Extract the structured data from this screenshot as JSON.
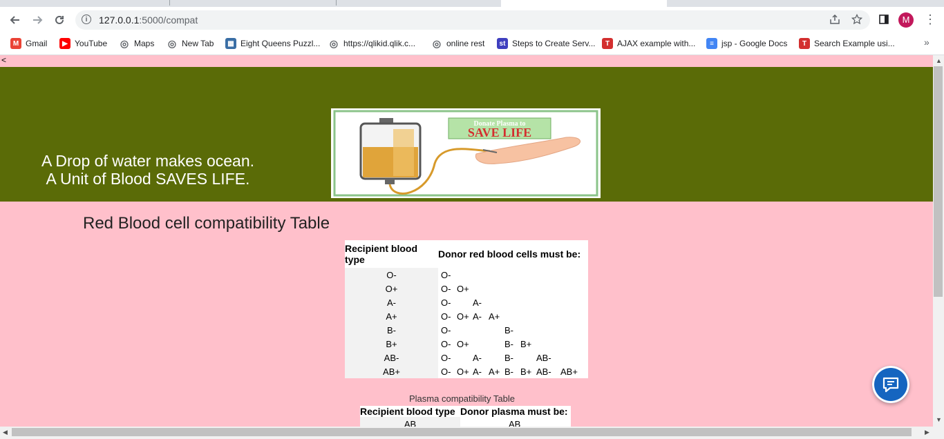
{
  "browser": {
    "url_host": "127.0.0.1",
    "url_path": ":5000/compat",
    "profile_initial": "M",
    "bookmarks": [
      {
        "label": "Gmail",
        "icon": "gmail-icon"
      },
      {
        "label": "YouTube",
        "icon": "youtube-icon"
      },
      {
        "label": "Maps",
        "icon": "globe-icon"
      },
      {
        "label": "New Tab",
        "icon": "globe-icon"
      },
      {
        "label": "Eight Queens Puzzl...",
        "icon": "image-icon"
      },
      {
        "label": "https://qlikid.qlik.c...",
        "icon": "globe-icon"
      },
      {
        "label": "online rest",
        "icon": "globe-icon"
      },
      {
        "label": "Steps to Create Serv...",
        "icon": "st-icon"
      },
      {
        "label": "AJAX example with...",
        "icon": "t-icon"
      },
      {
        "label": "jsp - Google Docs",
        "icon": "docs-icon"
      },
      {
        "label": "Search Example usi...",
        "icon": "t-icon"
      }
    ],
    "more_label": "»"
  },
  "page": {
    "back_marker": "<",
    "slogan_line1": "A Drop of water makes ocean.",
    "slogan_line2": "A Unit of Blood SAVES LIFE.",
    "poster_top": "Donate Plasma to",
    "poster_main": "SAVE LIFE",
    "rbc_title": "Red Blood cell compatibility Table",
    "rbc_header_recipient": "Recipient blood type",
    "rbc_header_donor": "Donor red blood cells must be:",
    "rbc_rows": [
      {
        "type": "O-",
        "donors": [
          "O-",
          "",
          "",
          "",
          "",
          "",
          "",
          ""
        ]
      },
      {
        "type": "O+",
        "donors": [
          "O-",
          "O+",
          "",
          "",
          "",
          "",
          "",
          ""
        ]
      },
      {
        "type": "A-",
        "donors": [
          "O-",
          "",
          "A-",
          "",
          "",
          "",
          "",
          ""
        ]
      },
      {
        "type": "A+",
        "donors": [
          "O-",
          "O+",
          "A-",
          "A+",
          "",
          "",
          "",
          ""
        ]
      },
      {
        "type": "B-",
        "donors": [
          "O-",
          "",
          "",
          "",
          "B-",
          "",
          "",
          ""
        ]
      },
      {
        "type": "B+",
        "donors": [
          "O-",
          "O+",
          "",
          "",
          "B-",
          "B+",
          "",
          ""
        ]
      },
      {
        "type": "AB-",
        "donors": [
          "O-",
          "",
          "A-",
          "",
          "B-",
          "",
          "AB-",
          ""
        ]
      },
      {
        "type": "AB+",
        "donors": [
          "O-",
          "O+",
          "A-",
          "A+",
          "B-",
          "B+",
          "AB-",
          "AB+"
        ]
      }
    ],
    "plasma_title": "Plasma compatibility Table",
    "plasma_header_recipient": "Recipient blood type",
    "plasma_header_donor": "Donor plasma must be:",
    "plasma_first_recipient": "AB",
    "plasma_first_donor": "AB"
  },
  "colors": {
    "page_bg": "#ffc0cb",
    "banner_bg": "#5a6b07",
    "chat_button": "#1565c0"
  }
}
